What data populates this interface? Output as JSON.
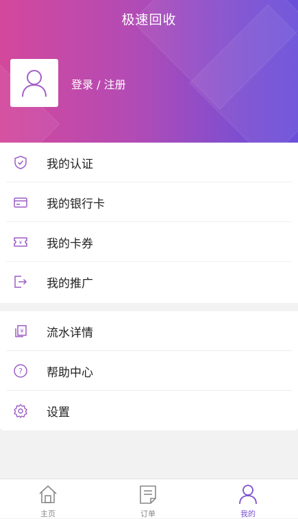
{
  "header": {
    "title": "极速回收",
    "login_label": "登录 / 注册",
    "gradient_colors": [
      "#d4489c",
      "#6a4fd9"
    ]
  },
  "menu_group_1": [
    {
      "label": "我的认证",
      "icon": "shield-check-icon"
    },
    {
      "label": "我的银行卡",
      "icon": "bank-card-icon"
    },
    {
      "label": "我的卡券",
      "icon": "coupon-icon"
    },
    {
      "label": "我的推广",
      "icon": "share-arrow-icon"
    }
  ],
  "menu_group_2": [
    {
      "label": "流水详情",
      "icon": "bill-icon"
    },
    {
      "label": "帮助中心",
      "icon": "help-icon"
    },
    {
      "label": "设置",
      "icon": "gear-icon"
    }
  ],
  "tabbar": {
    "items": [
      {
        "label": "主页",
        "icon": "home-icon"
      },
      {
        "label": "订单",
        "icon": "order-icon"
      },
      {
        "label": "我的",
        "icon": "user-icon"
      }
    ],
    "active": "我的",
    "active_color": "#7a4fd0"
  },
  "colors": {
    "icon_accent": "#9b5cc4"
  }
}
